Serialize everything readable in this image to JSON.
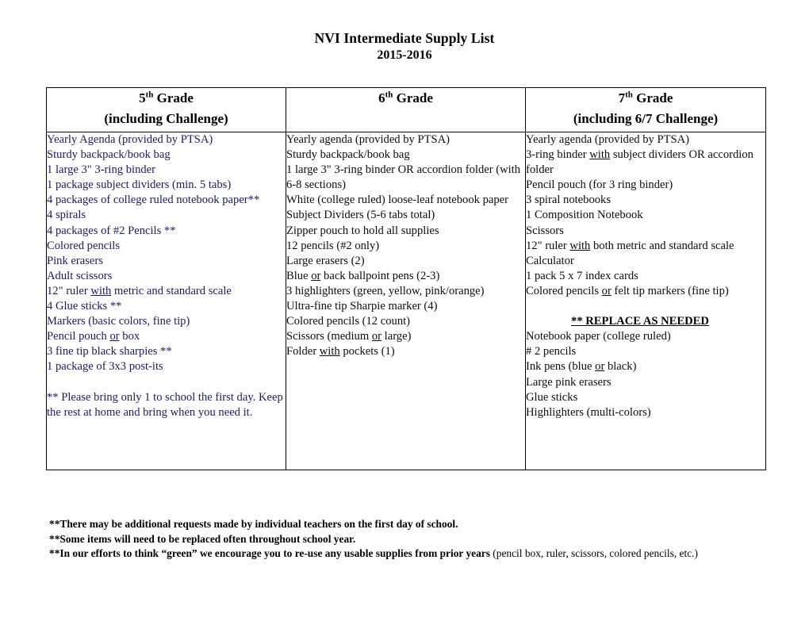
{
  "document": {
    "title": "NVI Intermediate Supply List",
    "subtitle": "2015-2016"
  },
  "colors": {
    "column_one_text": "#1c1c5e",
    "column_two_text": "#0d0d0d",
    "column_three_text": "#0d0d0d",
    "border": "#000000",
    "background": "#ffffff"
  },
  "table": {
    "columns": [
      {
        "grade_ordinal": "5",
        "grade_suffix": "th",
        "grade_label": "Grade",
        "subtitle": "(including Challenge)",
        "items": [
          "Yearly Agenda (provided by PTSA)",
          "Sturdy backpack/book bag",
          "1 large 3\" 3-ring binder",
          "1 package subject dividers (min. 5 tabs)",
          "4 packages of college ruled notebook paper**",
          "4 spirals",
          "4 packages of #2 Pencils **",
          "Colored pencils",
          "Pink erasers",
          "Adult scissors",
          "12\" ruler with metric and standard scale",
          "4 Glue sticks **",
          "Markers (basic colors, fine tip)",
          "Pencil pouch or box",
          "3 fine tip black sharpies **",
          "1 package of 3x3 post-its",
          "",
          "** Please bring only 1 to school the first day. Keep the rest at home and bring when you need it."
        ]
      },
      {
        "grade_ordinal": "6",
        "grade_suffix": "th",
        "grade_label": "Grade",
        "subtitle": "",
        "items": [
          "Yearly agenda (provided by PTSA)",
          "Sturdy backpack/book bag",
          "1 large 3\" 3-ring binder OR accordion folder (with 6-8 sections)",
          "White (college ruled) loose-leaf notebook paper",
          "Subject Dividers (5-6 tabs total)",
          "Zipper pouch to hold all supplies",
          "12 pencils (#2 only)",
          "Large erasers (2)",
          "Blue or back ballpoint pens (2-3)",
          "3 highlighters (green, yellow, pink/orange)",
          "Ultra-fine tip Sharpie marker (4)",
          "Colored pencils (12 count)",
          "Scissors (medium or large)",
          "Folder with pockets (1)"
        ]
      },
      {
        "grade_ordinal": "7",
        "grade_suffix": "th",
        "grade_label": "Grade",
        "subtitle": "(including 6/7 Challenge)",
        "items_before_heading": [
          "Yearly agenda (provided by PTSA)",
          "3-ring binder with subject dividers OR accordion folder",
          "Pencil pouch (for 3 ring binder)",
          "3 spiral notebooks",
          "1 Composition Notebook",
          "Scissors",
          "12\" ruler with both metric and standard scale",
          "Calculator",
          "1 pack 5 x 7 index cards",
          "Colored pencils or felt tip markers (fine tip)"
        ],
        "replace_heading": "** REPLACE AS NEEDED",
        "items_after_heading": [
          "Notebook paper (college ruled)",
          "# 2 pencils",
          "Ink pens (blue or black)",
          "Large pink erasers",
          "Glue sticks",
          "Highlighters (multi-colors)"
        ]
      }
    ]
  },
  "notes": [
    "**There may be additional requests made by individual teachers on the first day of school.",
    "**Some items will need to be replaced often throughout school year.",
    "**In our efforts to think “green” we encourage you to re-use any usable supplies from prior years",
    " (pencil box, ruler, scissors, colored pencils, etc.)"
  ]
}
